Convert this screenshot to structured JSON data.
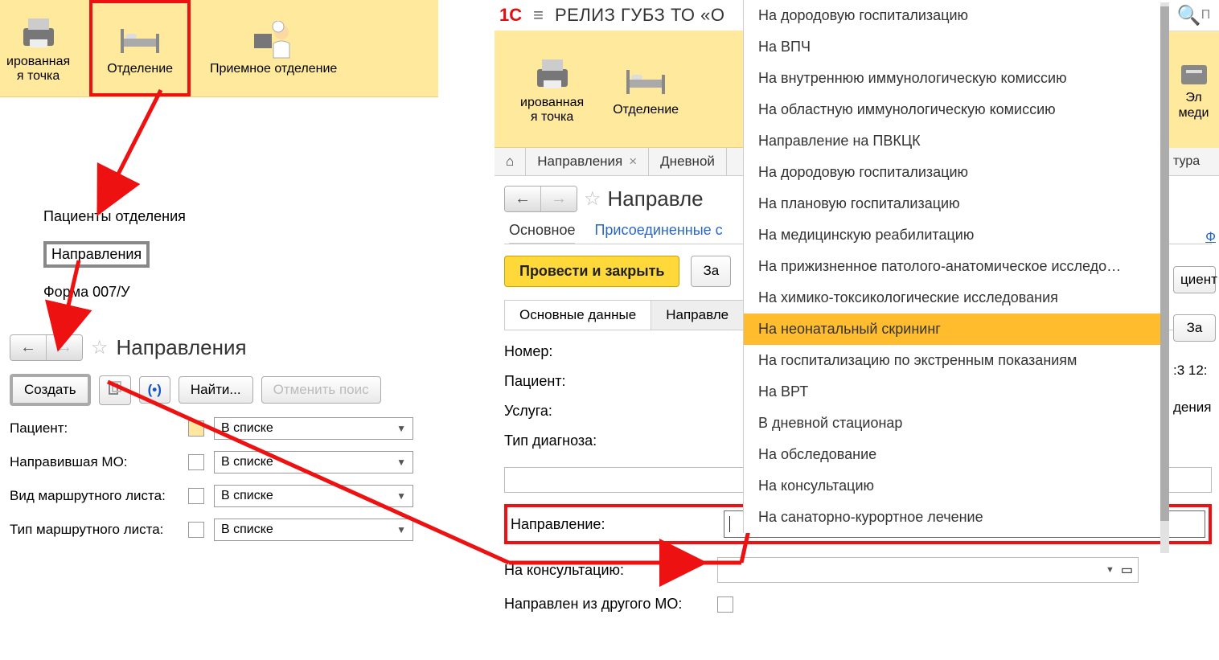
{
  "top_left": {
    "btn1_line1": "ированная",
    "btn1_line2": "я точка",
    "btn2": "Отделение",
    "btn3": "Приемное отделение"
  },
  "left_menu": {
    "item1": "Пациенты отделения",
    "item2": "Направления",
    "item3": "Форма 007/У"
  },
  "left_form": {
    "title": "Направления",
    "create": "Создать",
    "find": "Найти...",
    "cancel": "Отменить поис",
    "f1_label": "Пациент:",
    "f2_label": "Направившая МО:",
    "f3_label": "Вид маршрутного листа:",
    "f4_label": "Тип маршрутного листа:",
    "in_list": "В списке"
  },
  "right_top": {
    "title": "РЕЛИЗ ГУБЗ ТО «О"
  },
  "right_yellow": {
    "btn1_line1": "ированная",
    "btn1_line2": "я точка",
    "btn2": "Отделение"
  },
  "right_tabs": {
    "t1": "Направления",
    "t2": "Дневной"
  },
  "right_body": {
    "title": "Направле",
    "sect_main": "Основное",
    "sect_attached": "Присоединенные с",
    "cmd_primary": "Провести и закрыть",
    "cmd_write": "За",
    "inner_tab1": "Основные данные",
    "inner_tab2": "Направле",
    "num": "Номер:",
    "patient": "Пациент:",
    "service": "Услуга:",
    "dtype": "Тип диагноза:",
    "direction": "Направление:",
    "consult": "На консультацию:",
    "from_other": "Направлен из другого МО:"
  },
  "dropdown": [
    "На дородовую госпитализацию",
    "На ВПЧ",
    "На внутреннюю иммунологическую комиссию",
    "На областную иммунологическую комиссию",
    "Направление на ПВКЦК",
    "На дородовую госпитализацию",
    "На плановую госпитализацию",
    "На медицинскую реабилитацию",
    "На прижизненное патолого-анатомическое исследо…",
    "На химико-токсикологические исследования",
    "На неонатальный скрининг",
    "На госпитализацию по экстренным показаниям",
    "На ВРТ",
    "В дневной стационар",
    "На обследование",
    "На консультацию",
    "На санаторно-курортное лечение"
  ],
  "dd_sel_index": 10,
  "sliver": {
    "search": "П",
    "y1": "Эл",
    "y2": "меди",
    "tab": "тура",
    "link": "Ф",
    "btn": "циент",
    "btn2": "За",
    "time": ":3 12:",
    "dept": "дения"
  }
}
